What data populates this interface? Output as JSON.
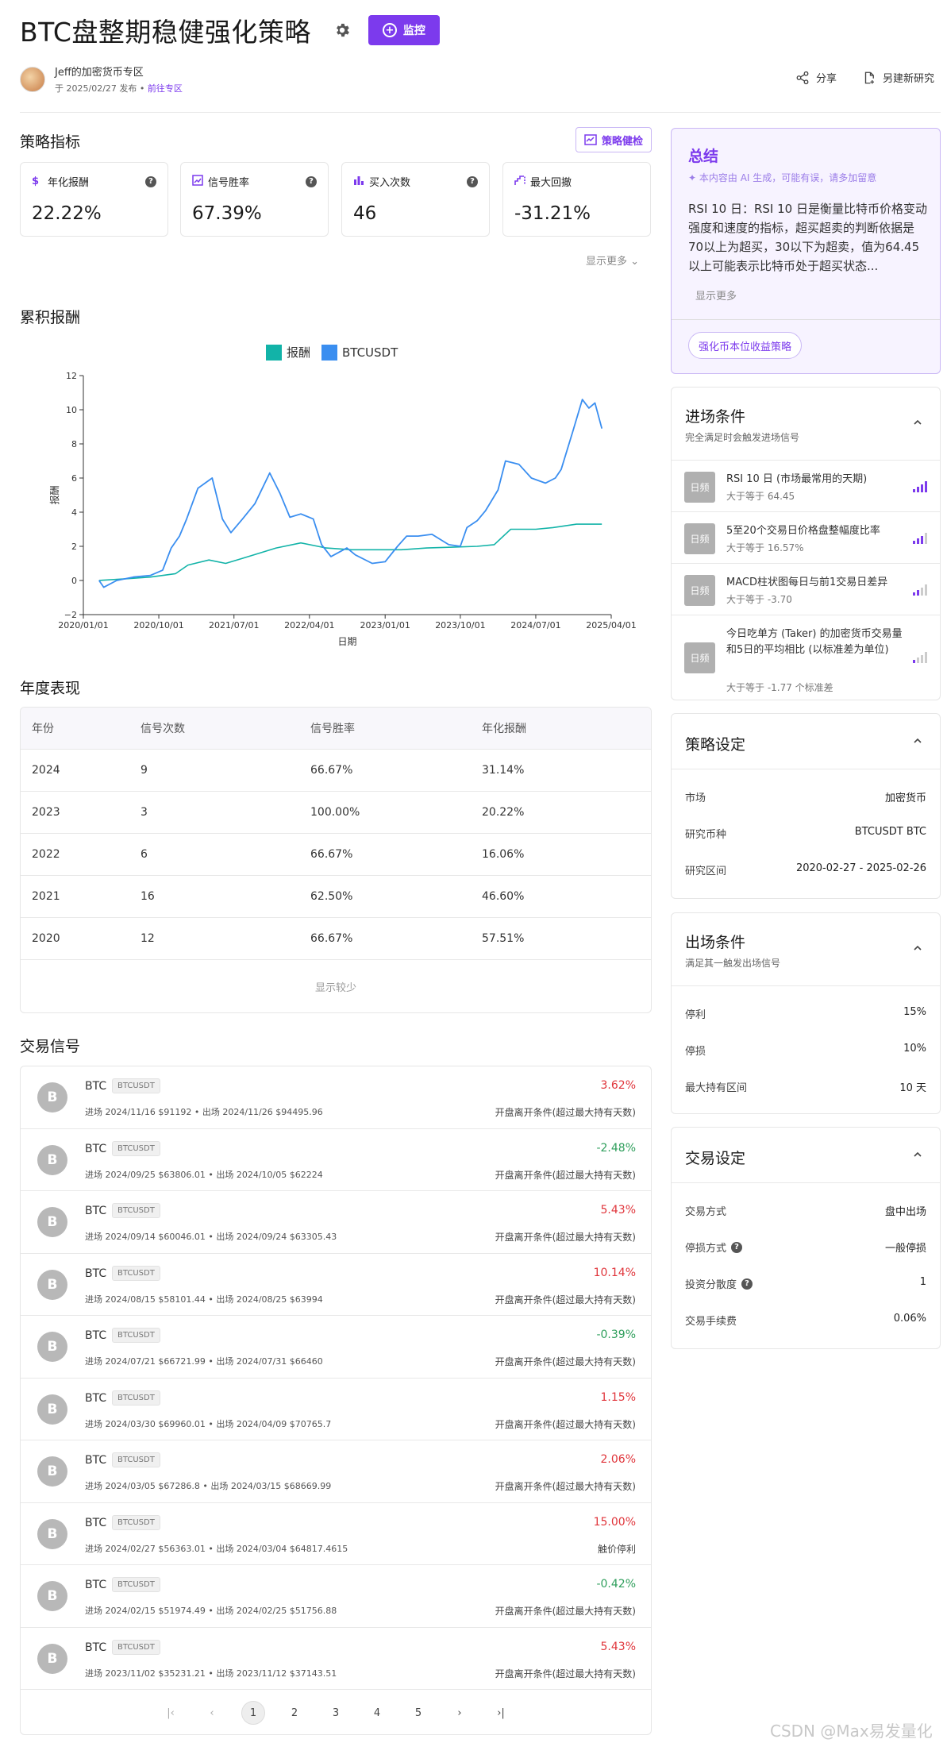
{
  "header": {
    "title": "BTC盘整期稳健强化策略",
    "monitor_label": "监控",
    "author_name": "Jeff的加密货币专区",
    "publish_info": "于 2025/02/27 发布",
    "zone_link": "前往专区",
    "share_label": "分享",
    "save_as_label": "另建新研究"
  },
  "metrics": {
    "section_title": "策略指标",
    "health_label": "策略健检",
    "items": [
      {
        "label": "年化报酬",
        "value": "22.22%",
        "icon": "dollar-icon"
      },
      {
        "label": "信号胜率",
        "value": "67.39%",
        "icon": "trend-chart-icon"
      },
      {
        "label": "买入次数",
        "value": "46",
        "icon": "bar-chart-icon"
      },
      {
        "label": "最大回撤",
        "value": "-31.21%",
        "icon": "drawdown-chart-icon"
      }
    ],
    "show_more": "显示更多"
  },
  "cumulative": {
    "section_title": "累积报酬"
  },
  "chart_data": {
    "type": "line",
    "title": "",
    "xlabel": "日期",
    "ylabel": "报酬",
    "ylim": [
      -2,
      12
    ],
    "y_ticks": [
      "12",
      "10",
      "8",
      "6",
      "4",
      "2",
      "0",
      "−2"
    ],
    "x_ticks": [
      "2020/01/01",
      "2020/10/01",
      "2021/07/01",
      "2022/04/01",
      "2023/01/01",
      "2023/10/01",
      "2024/07/01",
      "2025/04/01"
    ],
    "legend_position": "top-center",
    "series": [
      {
        "name": "报酬",
        "color": "#12b3a8",
        "x": [
          "2020/02/27",
          "2020/06/01",
          "2020/09/01",
          "2020/12/01",
          "2021/01/15",
          "2021/04/01",
          "2021/06/01",
          "2021/08/01",
          "2021/10/01",
          "2021/12/01",
          "2022/03/01",
          "2022/06/01",
          "2022/09/01",
          "2022/12/01",
          "2023/03/01",
          "2023/06/01",
          "2023/09/01",
          "2023/12/01",
          "2024/02/01",
          "2024/04/01",
          "2024/07/01",
          "2024/09/01",
          "2024/11/26",
          "2025/02/26"
        ],
        "values": [
          0,
          0.1,
          0.2,
          0.4,
          0.9,
          1.2,
          1.0,
          1.3,
          1.6,
          1.9,
          2.2,
          1.9,
          1.8,
          1.8,
          1.8,
          1.9,
          1.95,
          2.0,
          2.1,
          3.0,
          3.0,
          3.1,
          3.3,
          3.3
        ]
      },
      {
        "name": "BTCUSDT",
        "color": "#3a8ef0",
        "x": [
          "2020/02/27",
          "2020/03/15",
          "2020/05/01",
          "2020/07/01",
          "2020/09/01",
          "2020/10/15",
          "2020/11/15",
          "2020/12/15",
          "2021/01/10",
          "2021/02/20",
          "2021/04/13",
          "2021/05/20",
          "2021/06/20",
          "2021/08/01",
          "2021/09/15",
          "2021/11/08",
          "2021/12/15",
          "2022/01/20",
          "2022/03/01",
          "2022/04/15",
          "2022/05/15",
          "2022/06/18",
          "2022/08/15",
          "2022/09/15",
          "2022/11/15",
          "2023/01/01",
          "2023/02/15",
          "2023/03/20",
          "2023/05/01",
          "2023/06/20",
          "2023/08/20",
          "2023/10/01",
          "2023/10/25",
          "2023/12/01",
          "2024/01/01",
          "2024/02/15",
          "2024/03/13",
          "2024/05/01",
          "2024/06/15",
          "2024/08/05",
          "2024/09/10",
          "2024/10/01",
          "2024/11/12",
          "2024/12/17",
          "2025/01/10",
          "2025/02/01",
          "2025/02/26"
        ],
        "values": [
          0.0,
          -0.4,
          0.0,
          0.2,
          0.3,
          0.6,
          1.9,
          2.6,
          3.6,
          5.4,
          6.0,
          3.6,
          2.8,
          3.6,
          4.5,
          6.3,
          5.1,
          3.7,
          3.9,
          3.6,
          2.1,
          1.4,
          1.9,
          1.5,
          1.0,
          1.1,
          2.0,
          2.6,
          2.6,
          2.7,
          2.1,
          2.0,
          3.1,
          3.5,
          4.1,
          5.3,
          7.0,
          6.8,
          6.0,
          5.7,
          6.0,
          6.5,
          8.7,
          10.6,
          10.1,
          10.4,
          8.9
        ]
      }
    ]
  },
  "yearly": {
    "section_title": "年度表现",
    "headers": [
      "年份",
      "信号次数",
      "信号胜率",
      "年化报酬"
    ],
    "rows": [
      [
        "2024",
        "9",
        "66.67%",
        "31.14%"
      ],
      [
        "2023",
        "3",
        "100.00%",
        "20.22%"
      ],
      [
        "2022",
        "6",
        "66.67%",
        "16.06%"
      ],
      [
        "2021",
        "16",
        "62.50%",
        "46.60%"
      ],
      [
        "2020",
        "12",
        "66.67%",
        "57.51%"
      ]
    ],
    "show_less": "显示较少"
  },
  "signals": {
    "section_title": "交易信号",
    "items": [
      {
        "avatar": "B",
        "name": "BTC",
        "tag": "BTCUSDT",
        "meta": "进场 2024/11/16 $91192 • 出场 2024/11/26 $94495.96",
        "pct": "3.62%",
        "dir": "up",
        "reason": "开盘离开条件(超过最大持有天数)"
      },
      {
        "avatar": "B",
        "name": "BTC",
        "tag": "BTCUSDT",
        "meta": "进场 2024/09/25 $63806.01 • 出场 2024/10/05 $62224",
        "pct": "-2.48%",
        "dir": "down",
        "reason": "开盘离开条件(超过最大持有天数)"
      },
      {
        "avatar": "B",
        "name": "BTC",
        "tag": "BTCUSDT",
        "meta": "进场 2024/09/14 $60046.01 • 出场 2024/09/24 $63305.43",
        "pct": "5.43%",
        "dir": "up",
        "reason": "开盘离开条件(超过最大持有天数)"
      },
      {
        "avatar": "B",
        "name": "BTC",
        "tag": "BTCUSDT",
        "meta": "进场 2024/08/15 $58101.44 • 出场 2024/08/25 $63994",
        "pct": "10.14%",
        "dir": "up",
        "reason": "开盘离开条件(超过最大持有天数)"
      },
      {
        "avatar": "B",
        "name": "BTC",
        "tag": "BTCUSDT",
        "meta": "进场 2024/07/21 $66721.99 • 出场 2024/07/31 $66460",
        "pct": "-0.39%",
        "dir": "down",
        "reason": "开盘离开条件(超过最大持有天数)"
      },
      {
        "avatar": "B",
        "name": "BTC",
        "tag": "BTCUSDT",
        "meta": "进场 2024/03/30 $69960.01 • 出场 2024/04/09 $70765.7",
        "pct": "1.15%",
        "dir": "up",
        "reason": "开盘离开条件(超过最大持有天数)"
      },
      {
        "avatar": "B",
        "name": "BTC",
        "tag": "BTCUSDT",
        "meta": "进场 2024/03/05 $67286.8 • 出场 2024/03/15 $68669.99",
        "pct": "2.06%",
        "dir": "up",
        "reason": "开盘离开条件(超过最大持有天数)"
      },
      {
        "avatar": "B",
        "name": "BTC",
        "tag": "BTCUSDT",
        "meta": "进场 2024/02/27 $56363.01 • 出场 2024/03/04 $64817.4615",
        "pct": "15.00%",
        "dir": "up",
        "reason": "触价停利"
      },
      {
        "avatar": "B",
        "name": "BTC",
        "tag": "BTCUSDT",
        "meta": "进场 2024/02/15 $51974.49 • 出场 2024/02/25 $51756.88",
        "pct": "-0.42%",
        "dir": "down",
        "reason": "开盘离开条件(超过最大持有天数)"
      },
      {
        "avatar": "B",
        "name": "BTC",
        "tag": "BTCUSDT",
        "meta": "进场 2023/11/02 $35231.21 • 出场 2023/11/12 $37143.51",
        "pct": "5.43%",
        "dir": "up",
        "reason": "开盘离开条件(超过最大持有天数)"
      }
    ],
    "pages": [
      "1",
      "2",
      "3",
      "4",
      "5"
    ],
    "current_page": "1"
  },
  "summary": {
    "title": "总结",
    "note": "本内容由 AI 生成，可能有误，请多加留意",
    "text": "RSI 10 日：RSI 10 日是衡量比特币价格变动强度和速度的指标，超买超卖的判断依据是70以上为超买，30以下为超卖，值为64.45以上可能表示比特币处于超买状态...",
    "show_more": "显示更多",
    "button": "强化币本位收益策略"
  },
  "entry": {
    "title": "进场条件",
    "subtitle": "完全满足时会触发进场信号",
    "items": [
      {
        "freq": "日频",
        "name": "RSI 10 日 (市场最常用的天期)",
        "cond": "大于等于 64.45",
        "strength": 4
      },
      {
        "freq": "日频",
        "name": "5至20个交易日价格盘整幅度比率",
        "cond": "大于等于 16.57%",
        "strength": 3
      },
      {
        "freq": "日频",
        "name": "MACD柱状图每日与前1交易日差异",
        "cond": "大于等于 -3.70",
        "strength": 2
      },
      {
        "freq": "日频",
        "name": "今日吃单方 (Taker) 的加密货币交易量和5日的平均相比 (以标准差为单位)",
        "cond": "大于等于 -1.77 个标准差",
        "strength": 1
      }
    ]
  },
  "strategy_settings": {
    "title": "策略设定",
    "rows": [
      {
        "k": "市场",
        "v": "加密货币"
      },
      {
        "k": "研究币种",
        "v": "BTCUSDT BTC"
      },
      {
        "k": "研究区间",
        "v": "2020-02-27 - 2025-02-26"
      }
    ]
  },
  "exit": {
    "title": "出场条件",
    "subtitle": "满足其一触发出场信号",
    "rows": [
      {
        "k": "停利",
        "v": "15%"
      },
      {
        "k": "停损",
        "v": "10%"
      },
      {
        "k": "最大持有区间",
        "v": "10 天"
      }
    ]
  },
  "trade_settings": {
    "title": "交易设定",
    "rows": [
      {
        "k": "交易方式",
        "v": "盘中出场",
        "help": false
      },
      {
        "k": "停损方式",
        "v": "一般停损",
        "help": true
      },
      {
        "k": "投资分散度",
        "v": "1",
        "help": true
      },
      {
        "k": "交易手续费",
        "v": "0.06%",
        "help": false
      }
    ]
  },
  "watermark": "CSDN @Max易发量化",
  "colors": {
    "accent": "#7c3aed",
    "up": "#e0353b",
    "down": "#2e9e5b"
  }
}
